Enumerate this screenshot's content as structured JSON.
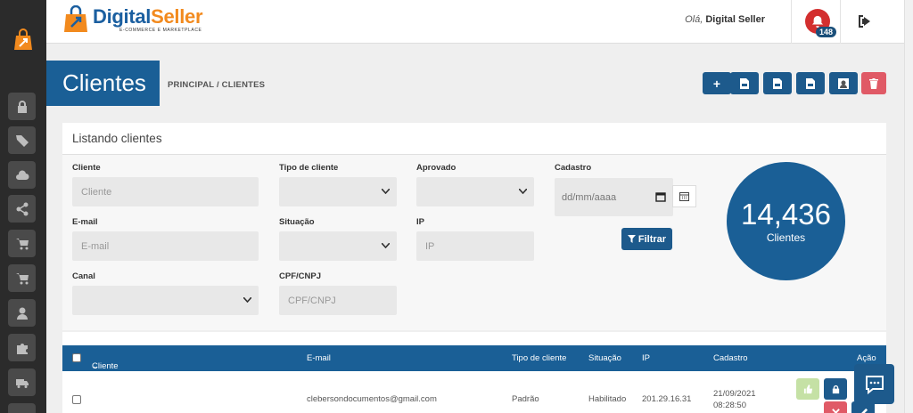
{
  "brand": {
    "name_part1": "Digital",
    "name_part2": "Seller",
    "tagline": "E-COMMERCE E MARKETPLACE"
  },
  "header": {
    "greeting_prefix": "Olá,",
    "greeting_name": "Digital Seller",
    "notification_count": "148"
  },
  "sidebar": {
    "icons": [
      "lock-icon",
      "tags-icon",
      "cloud-icon",
      "share-icon",
      "cart-icon",
      "cart-icon",
      "user-icon",
      "puzzle-icon",
      "truck-icon"
    ]
  },
  "page": {
    "title": "Clientes",
    "breadcrumb": "PRINCIPAL / CLIENTES"
  },
  "toolbar": {
    "add": "+",
    "buttons": [
      "add-button",
      "export-csv-button",
      "export-xls-button",
      "export-pdf-button",
      "import-button",
      "delete-button"
    ]
  },
  "filters": {
    "heading": "Listando clientes",
    "cliente_label": "Cliente",
    "cliente_placeholder": "Cliente",
    "email_label": "E-mail",
    "email_placeholder": "E-mail",
    "canal_label": "Canal",
    "tipo_label": "Tipo de cliente",
    "situacao_label": "Situação",
    "cpf_label": "CPF/CNPJ",
    "cpf_placeholder": "CPF/CNPJ",
    "aprovado_label": "Aprovado",
    "ip_label": "IP",
    "ip_placeholder": "IP",
    "cadastro_label": "Cadastro",
    "cadastro_placeholder": "dd/mm/aaaa",
    "filter_button": "Filtrar"
  },
  "summary": {
    "total": "14,436",
    "label": "Clientes"
  },
  "table": {
    "columns": {
      "cliente": "Cliente",
      "email": "E-mail",
      "tipo": "Tipo de cliente",
      "situacao": "Situação",
      "ip": "IP",
      "cadastro": "Cadastro",
      "acao": "Ação"
    },
    "rows": [
      {
        "email": "clebersondocumentos@gmail.com",
        "tipo": "Padrão",
        "situacao": "Habilitado",
        "ip": "201.29.16.31",
        "date": "21/09/2021",
        "time": "08:28:50"
      }
    ]
  },
  "colors": {
    "primary": "#1a5f96",
    "button": "#1d5a8c",
    "danger": "#e05a66",
    "alert": "#d32f2f",
    "sidebar": "#2b2b2b",
    "approve": "#c5e1a5"
  }
}
